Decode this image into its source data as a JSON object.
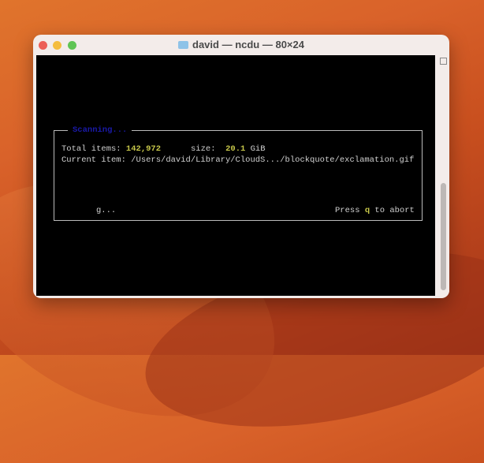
{
  "window": {
    "title": "david — ncdu — 80×24"
  },
  "ncdu": {
    "heading": "Scanning...",
    "total_label": "Total items: ",
    "total_value": "142,972",
    "size_label": "size:  ",
    "size_value": "20.1",
    "size_unit": " GiB",
    "current_label": "Current item: ",
    "current_path": "/Users/david/Library/CloudS.../blockquote/exclamation.gif",
    "spinner": "g...",
    "abort_pre": "Press ",
    "abort_key": "q",
    "abort_post": " to abort"
  }
}
